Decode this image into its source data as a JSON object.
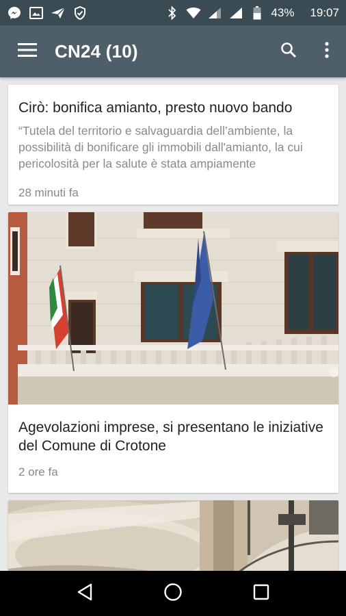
{
  "status_bar": {
    "battery": "43%",
    "time": "19:07",
    "icons_left": [
      "messenger-icon",
      "image-icon",
      "send-icon",
      "shield-icon"
    ],
    "icons_right": [
      "bluetooth-icon",
      "wifi-icon",
      "signal-icon",
      "signal-icon",
      "battery-icon"
    ]
  },
  "app_bar": {
    "title": "CN24 (10)",
    "background": "#4e5f69",
    "status_background": "#3a4b54"
  },
  "articles": [
    {
      "title": "Cirò: bonifica amianto, presto nuovo bando",
      "excerpt": "“Tutela del territorio e salvaguardia dell’ambiente, la possibilità di bonificare gli immobili dall'amianto, la cui pericolosità per la salute è stata ampiamente",
      "time": "28 minuti fa"
    },
    {
      "title": "Agevolazioni imprese, si presentano le iniziative del Comune di Crotone",
      "time": "2 ore fa",
      "image": "building-with-flags-photo"
    },
    {
      "image": "drums-photo"
    }
  ],
  "nav_bar": {
    "buttons": [
      "back-icon",
      "home-icon",
      "recents-icon"
    ]
  }
}
